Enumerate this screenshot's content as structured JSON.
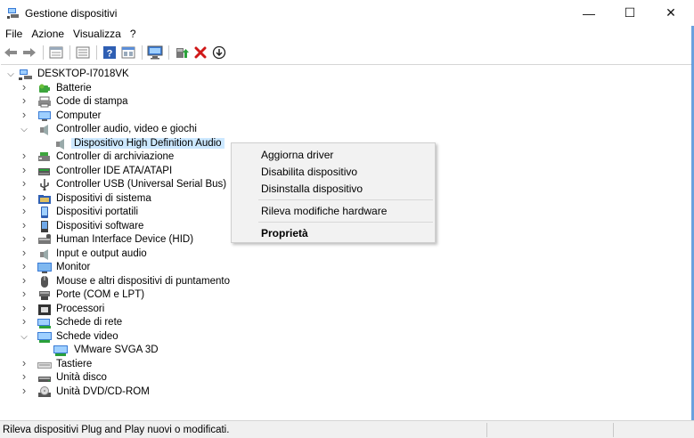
{
  "window": {
    "title": "Gestione dispositivi",
    "minimize_glyph": "—",
    "maximize_glyph": "☐",
    "close_glyph": "✕"
  },
  "menu": [
    "File",
    "Azione",
    "Visualizza",
    "?"
  ],
  "toolbar": [
    "back-arrow-icon",
    "forward-arrow-icon",
    "separator",
    "properties-grid-icon",
    "separator",
    "view-list-icon",
    "separator",
    "help-icon",
    "resources-icon",
    "separator",
    "monitor-scan-icon",
    "separator",
    "update-driver-icon",
    "uninstall-x-icon",
    "download-circle-icon"
  ],
  "tree": {
    "root": "DESKTOP-I7018VK",
    "items": [
      {
        "label": "Batterie",
        "icon": "battery-icon",
        "expanded": false
      },
      {
        "label": "Code di stampa",
        "icon": "printer-queue-icon",
        "expanded": false
      },
      {
        "label": "Computer",
        "icon": "computer-icon",
        "expanded": false
      },
      {
        "label": "Controller audio, video e giochi",
        "icon": "speaker-icon",
        "expanded": true
      },
      {
        "label": "Dispositivo High Definition Audio",
        "icon": "speaker-icon",
        "child": true,
        "selected": true
      },
      {
        "label": "Controller di archiviazione",
        "icon": "storage-controller-icon",
        "expanded": false
      },
      {
        "label": "Controller IDE ATA/ATAPI",
        "icon": "ide-controller-icon",
        "expanded": false
      },
      {
        "label": "Controller USB (Universal Serial Bus)",
        "icon": "usb-icon",
        "expanded": false
      },
      {
        "label": "Dispositivi di sistema",
        "icon": "system-folder-icon",
        "expanded": false
      },
      {
        "label": "Dispositivi portatili",
        "icon": "portable-device-icon",
        "expanded": false
      },
      {
        "label": "Dispositivi software",
        "icon": "software-device-icon",
        "expanded": false
      },
      {
        "label": "Human Interface Device (HID)",
        "icon": "hid-icon",
        "expanded": false
      },
      {
        "label": "Input e output audio",
        "icon": "audio-io-icon",
        "expanded": false
      },
      {
        "label": "Monitor",
        "icon": "monitor-icon",
        "expanded": false
      },
      {
        "label": "Mouse e altri dispositivi di puntamento",
        "icon": "mouse-icon",
        "expanded": false
      },
      {
        "label": "Porte (COM e LPT)",
        "icon": "port-icon",
        "expanded": false
      },
      {
        "label": "Processori",
        "icon": "processor-icon",
        "expanded": false
      },
      {
        "label": "Schede di rete",
        "icon": "network-adapter-icon",
        "expanded": false
      },
      {
        "label": "Schede video",
        "icon": "display-adapter-icon",
        "expanded": true
      },
      {
        "label": "VMware SVGA 3D",
        "icon": "display-adapter-icon",
        "child": true
      },
      {
        "label": "Tastiere",
        "icon": "keyboard-icon",
        "expanded": false
      },
      {
        "label": "Unità disco",
        "icon": "disk-drive-icon",
        "expanded": false
      },
      {
        "label": "Unità DVD/CD-ROM",
        "icon": "dvd-drive-icon",
        "expanded": false
      }
    ]
  },
  "context_menu": {
    "items": [
      {
        "label": "Aggiorna driver"
      },
      {
        "label": "Disabilita dispositivo"
      },
      {
        "label": "Disinstalla dispositivo"
      },
      {
        "label": "Rileva modifiche hardware"
      },
      {
        "label": "Proprietà",
        "bold": true
      }
    ]
  },
  "statusbar": {
    "text": "Rileva dispositivi Plug and Play nuovi o modificati."
  },
  "colors": {
    "selection": "#cce8ff",
    "menu_bg": "#f2f2f2",
    "accent": "#2b79d0"
  }
}
